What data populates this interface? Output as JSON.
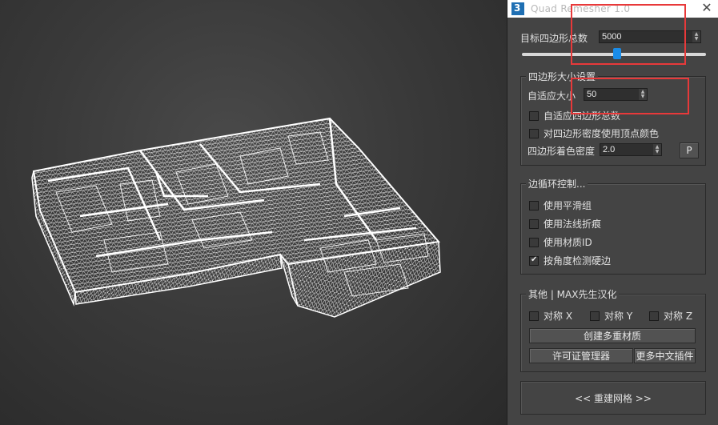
{
  "window": {
    "title": "Quad Remesher 1.0",
    "close_glyph": "✕"
  },
  "target_count": {
    "label": "目标四边形总数",
    "value": "5000",
    "slider_fraction": 0.52
  },
  "quad_size": {
    "group_title": "四边形大小设置",
    "adaptive_label": "自适应大小",
    "adaptive_value": "50",
    "options": [
      {
        "label": "自适应四边形总数",
        "checked": false
      },
      {
        "label": "对四边形密度使用顶点颜色",
        "checked": false
      }
    ],
    "density_label": "四边形着色密度",
    "density_value": "2.0",
    "p_button": "P"
  },
  "edge_loops": {
    "group_title": "边循环控制...",
    "options": [
      {
        "label": "使用平滑组",
        "checked": false
      },
      {
        "label": "使用法线折痕",
        "checked": false
      },
      {
        "label": "使用材质ID",
        "checked": false
      },
      {
        "label": "按角度检测硬边",
        "checked": true
      }
    ]
  },
  "other": {
    "group_title": "其他 | MAX先生汉化",
    "symmetry": [
      {
        "label": "对称 X",
        "checked": false
      },
      {
        "label": "对称 Y",
        "checked": false
      },
      {
        "label": "对称 Z",
        "checked": false
      }
    ],
    "multi_material_button": "创建多重材质",
    "license_button": "许可证管理器",
    "more_plugins_button": "更多中文插件"
  },
  "rebuild_button": "<<  重建网格  >>",
  "colors": {
    "panel_bg": "#444444",
    "accent_blue": "#1a8ce8",
    "annotation_red": "#e8393a",
    "mesh_white": "#ffffff"
  }
}
